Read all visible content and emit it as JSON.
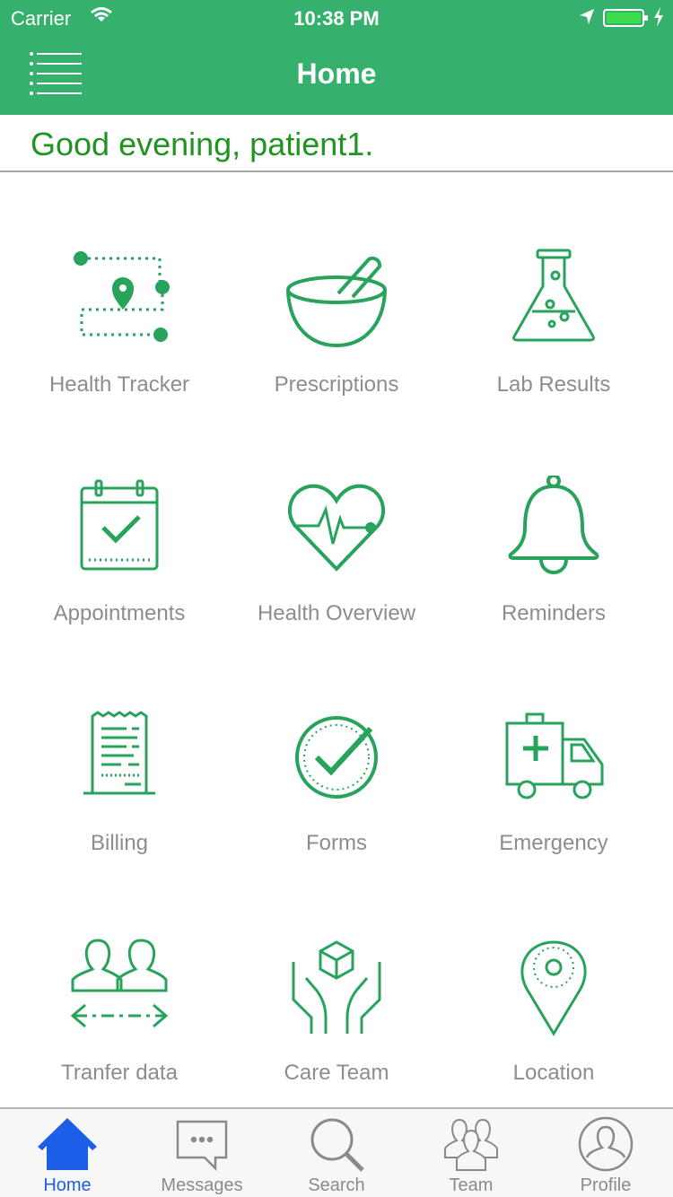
{
  "status_bar": {
    "carrier": "Carrier",
    "time": "10:38 PM"
  },
  "nav": {
    "title": "Home"
  },
  "greeting": "Good evening, patient1.",
  "colors": {
    "brand_green": "#36b16d",
    "icon_green": "#27a35c",
    "greeting_green": "#1f9420",
    "tab_active": "#1d5ee8"
  },
  "tiles": [
    {
      "label": "Health Tracker",
      "icon": "route-map-icon"
    },
    {
      "label": "Prescriptions",
      "icon": "mortar-pestle-icon"
    },
    {
      "label": "Lab Results",
      "icon": "flask-icon"
    },
    {
      "label": "Appointments",
      "icon": "calendar-check-icon"
    },
    {
      "label": "Health Overview",
      "icon": "heart-pulse-icon"
    },
    {
      "label": "Reminders",
      "icon": "bell-icon"
    },
    {
      "label": "Billing",
      "icon": "receipt-icon"
    },
    {
      "label": "Forms",
      "icon": "check-circle-icon"
    },
    {
      "label": "Emergency",
      "icon": "ambulance-icon"
    },
    {
      "label": "Tranfer data",
      "icon": "transfer-users-icon"
    },
    {
      "label": "Care Team",
      "icon": "hands-box-icon"
    },
    {
      "label": "Location",
      "icon": "location-pin-icon"
    }
  ],
  "tabs": [
    {
      "label": "Home",
      "icon": "home-icon",
      "active": true
    },
    {
      "label": "Messages",
      "icon": "message-icon",
      "active": false
    },
    {
      "label": "Search",
      "icon": "search-icon",
      "active": false
    },
    {
      "label": "Team",
      "icon": "team-icon",
      "active": false
    },
    {
      "label": "Profile",
      "icon": "profile-icon",
      "active": false
    }
  ]
}
